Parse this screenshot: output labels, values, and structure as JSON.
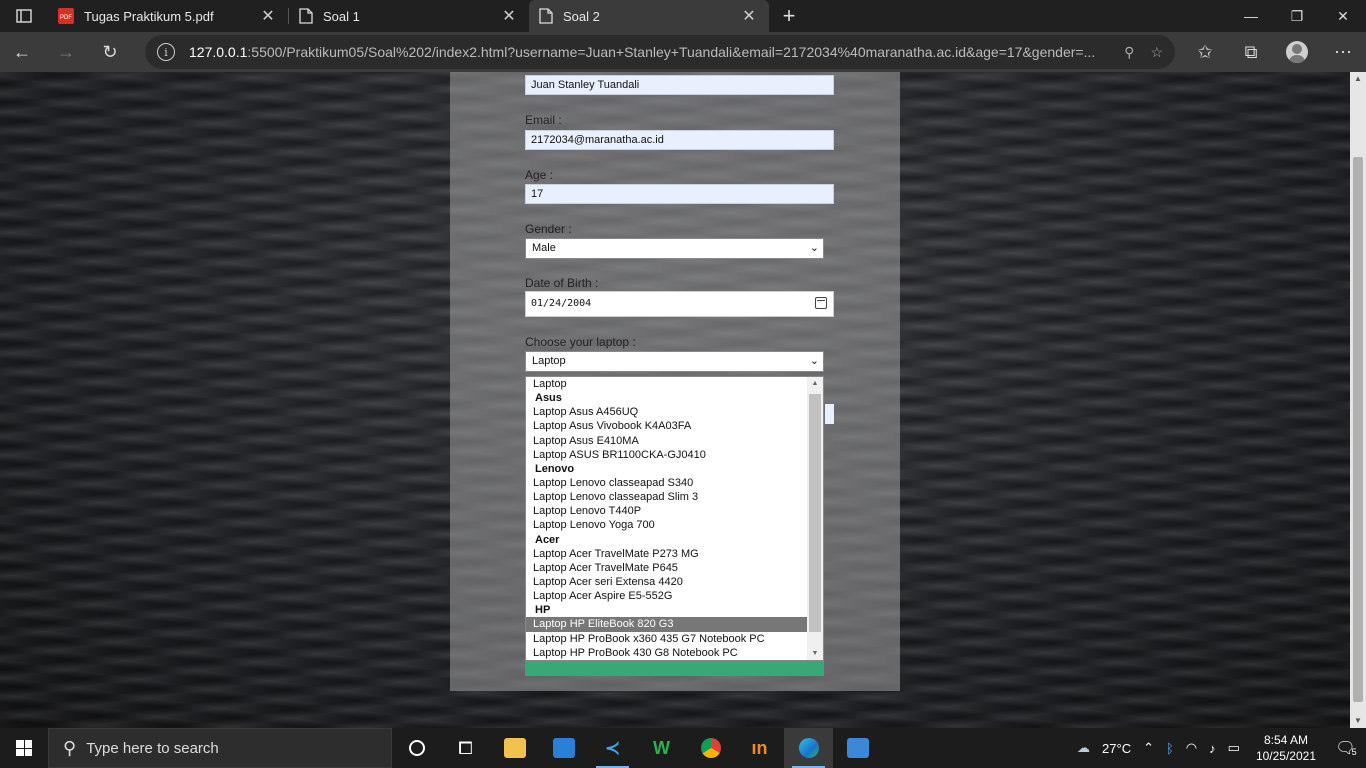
{
  "browser": {
    "tabs": [
      {
        "title": "Tugas Praktikum 5.pdf",
        "icon": "pdf-icon",
        "active": false
      },
      {
        "title": "Soal 1",
        "icon": "page-icon",
        "active": false
      },
      {
        "title": "Soal 2",
        "icon": "page-icon",
        "active": true
      }
    ],
    "url_host": "127.0.0.1",
    "url_rest": ":5500/Praktikum05/Soal%202/index2.html?username=Juan+Stanley+Tuandali&email=2172034%40maranatha.ac.id&age=17&gender=..."
  },
  "form": {
    "name_value": "Juan Stanley Tuandali",
    "email_label": "Email :",
    "email_value": "2172034@maranatha.ac.id",
    "age_label": "Age :",
    "age_value": "17",
    "gender_label": "Gender :",
    "gender_value": "Male",
    "dob_label": "Date of Birth :",
    "dob_value": "01/24/2004",
    "laptop_label": "Choose your laptop :",
    "laptop_value": "Laptop"
  },
  "laptop_options": [
    {
      "text": "Laptop",
      "group": false,
      "selected": false
    },
    {
      "text": "Asus",
      "group": true,
      "selected": false
    },
    {
      "text": "Laptop Asus A456UQ",
      "group": false,
      "selected": false
    },
    {
      "text": "Laptop Asus Vivobook K4A03FA",
      "group": false,
      "selected": false
    },
    {
      "text": "Laptop Asus E410MA",
      "group": false,
      "selected": false
    },
    {
      "text": "Laptop ASUS BR1100CKA-GJ0410",
      "group": false,
      "selected": false
    },
    {
      "text": "Lenovo",
      "group": true,
      "selected": false
    },
    {
      "text": "Laptop Lenovo classeapad S340",
      "group": false,
      "selected": false
    },
    {
      "text": "Laptop Lenovo classeapad Slim 3",
      "group": false,
      "selected": false
    },
    {
      "text": "Laptop Lenovo T440P",
      "group": false,
      "selected": false
    },
    {
      "text": "Laptop Lenovo Yoga 700",
      "group": false,
      "selected": false
    },
    {
      "text": "Acer",
      "group": true,
      "selected": false
    },
    {
      "text": "Laptop Acer TravelMate P273 MG",
      "group": false,
      "selected": false
    },
    {
      "text": "Laptop Acer TravelMate P645",
      "group": false,
      "selected": false
    },
    {
      "text": "Laptop Acer seri Extensa 4420",
      "group": false,
      "selected": false
    },
    {
      "text": "Laptop Acer Aspire E5-552G",
      "group": false,
      "selected": false
    },
    {
      "text": "HP",
      "group": true,
      "selected": false
    },
    {
      "text": "Laptop HP EliteBook 820 G3",
      "group": false,
      "selected": true
    },
    {
      "text": "Laptop HP ProBook x360 435 G7 Notebook PC",
      "group": false,
      "selected": false
    },
    {
      "text": "Laptop HP ProBook 430 G8 Notebook PC",
      "group": false,
      "selected": false
    }
  ],
  "taskbar": {
    "search_placeholder": "Type here to search",
    "weather": "27°C",
    "time": "8:54 AM",
    "date": "10/25/2021",
    "notif_count": "5"
  },
  "colors": {
    "submit_button": "#3aa876",
    "input_autofill": "#e8f0fe",
    "selected_option": "#777777"
  }
}
